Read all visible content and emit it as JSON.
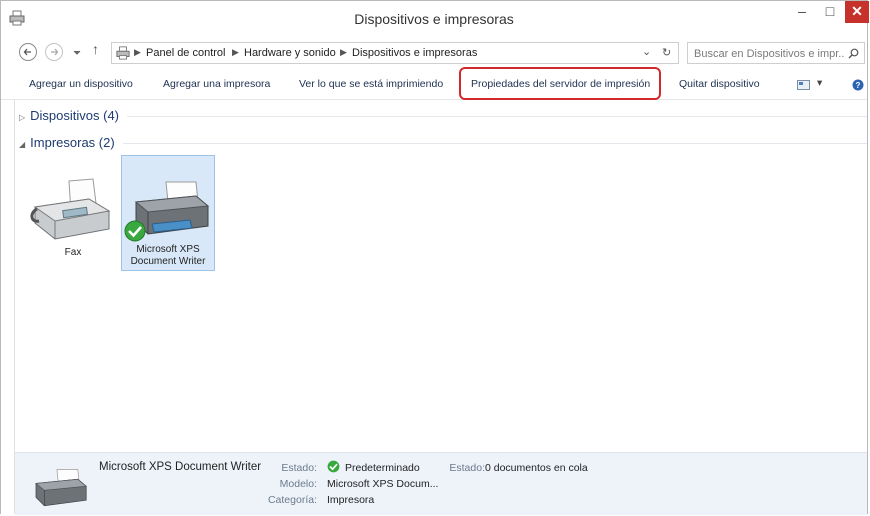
{
  "window": {
    "title": "Dispositivos e impresoras",
    "app_icon": "printer-icon",
    "minimize": "–",
    "maximize": "□",
    "close": "✕"
  },
  "nav": {
    "back_icon": "back-arrow-icon",
    "forward_icon": "forward-arrow-icon",
    "recent_icon": "chevron-down-icon",
    "up": "↑"
  },
  "address": {
    "breadcrumbs": [
      "Panel de control",
      "Hardware y sonido",
      "Dispositivos e impresoras"
    ],
    "dropdown": "⌄",
    "refresh": "↻"
  },
  "search": {
    "placeholder": "Buscar en Dispositivos e impr...",
    "icon": "search-icon"
  },
  "toolbar": {
    "add_device": "Agregar un dispositivo",
    "add_printer": "Agregar una impresora",
    "see_printing": "Ver lo que se está imprimiendo",
    "server_properties": "Propiedades del servidor de impresión",
    "remove_device": "Quitar dispositivo",
    "view_dropdown": "▾",
    "help": "?"
  },
  "groups": {
    "devices": {
      "label": "Dispositivos (4)",
      "toggle": "▷"
    },
    "printers": {
      "label": "Impresoras (2)",
      "toggle": "◢"
    }
  },
  "printers": [
    {
      "name": "Fax",
      "selected": false
    },
    {
      "name_line1": "Microsoft XPS",
      "name_line2": "Document Writer",
      "selected": true,
      "default": true
    }
  ],
  "details": {
    "name": "Microsoft XPS Document Writer",
    "estado_label": "Estado:",
    "estado_value": "Predeterminado",
    "estado2_label": "Estado:",
    "estado2_value": "0 documentos en cola",
    "modelo_label": "Modelo:",
    "modelo_value": "Microsoft XPS Docum...",
    "categoria_label": "Categoría:",
    "categoria_value": "Impresora"
  }
}
